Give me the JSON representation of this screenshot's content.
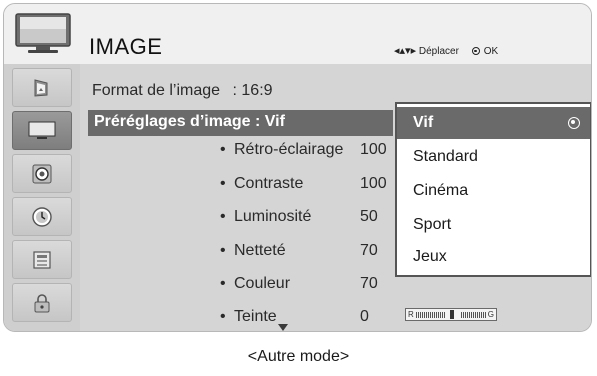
{
  "header": {
    "title": "IMAGE",
    "move_label": "Déplacer",
    "ok_label": "OK",
    "icon": "tv-monitor-icon"
  },
  "sidebar": {
    "items": [
      {
        "icon": "picture-icon",
        "active": false
      },
      {
        "icon": "tv-screen-icon",
        "active": true
      },
      {
        "icon": "speaker-icon",
        "active": false
      },
      {
        "icon": "clock-icon",
        "active": false
      },
      {
        "icon": "option-icon",
        "active": false
      },
      {
        "icon": "lock-icon",
        "active": false
      }
    ]
  },
  "menu": {
    "format_label": "Format de l’image",
    "format_value": ": 16:9",
    "preset_label": "Préréglages d’image : Vif",
    "settings": [
      {
        "name": "Rétro-éclairage",
        "value": "100"
      },
      {
        "name": "Contraste",
        "value": "100"
      },
      {
        "name": "Luminosité",
        "value": "50"
      },
      {
        "name": "Netteté",
        "value": "70"
      },
      {
        "name": "Couleur",
        "value": "70"
      },
      {
        "name": "Teinte",
        "value": "0"
      }
    ],
    "bullet": "•",
    "tint_bar": {
      "left": "R",
      "right": "G",
      "value": 0
    }
  },
  "dropdown": {
    "options": [
      "Vif",
      "Standard",
      "Cinéma",
      "Sport",
      "Jeux"
    ],
    "selected": "Vif"
  },
  "caption": "<Autre mode>",
  "colors": {
    "highlight": "#6a6a6a",
    "panel": "#d5d5d5",
    "sidebar": "#cfcfcf",
    "header": "#f0f0f0"
  }
}
